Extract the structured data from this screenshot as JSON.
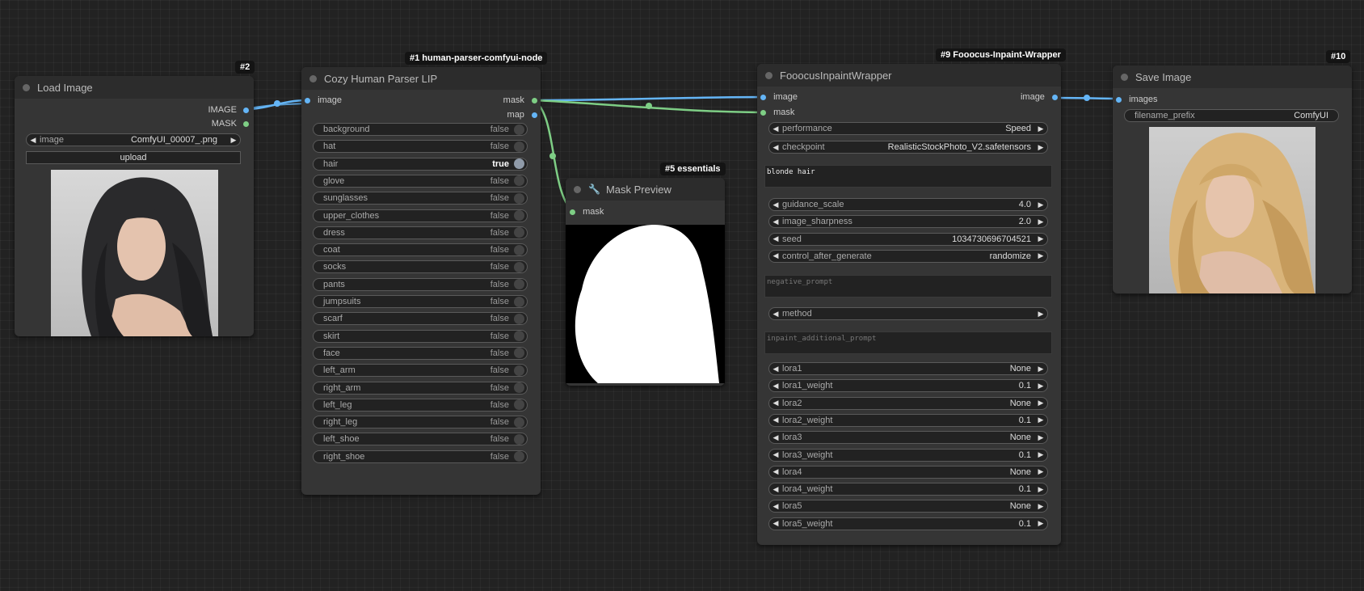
{
  "nodes": {
    "load_image": {
      "badge": "#2",
      "title": "Load Image",
      "outputs": [
        "IMAGE",
        "MASK"
      ],
      "image_widget": {
        "label": "image",
        "value": "ComfyUI_00007_.png"
      },
      "upload_label": "upload"
    },
    "parser": {
      "badge": "#1 human-parser-comfyui-node",
      "title": "Cozy Human Parser LIP",
      "input": "image",
      "outputs": [
        "mask",
        "map"
      ],
      "toggles": [
        {
          "label": "background",
          "value": "false"
        },
        {
          "label": "hat",
          "value": "false"
        },
        {
          "label": "hair",
          "value": "true"
        },
        {
          "label": "glove",
          "value": "false"
        },
        {
          "label": "sunglasses",
          "value": "false"
        },
        {
          "label": "upper_clothes",
          "value": "false"
        },
        {
          "label": "dress",
          "value": "false"
        },
        {
          "label": "coat",
          "value": "false"
        },
        {
          "label": "socks",
          "value": "false"
        },
        {
          "label": "pants",
          "value": "false"
        },
        {
          "label": "jumpsuits",
          "value": "false"
        },
        {
          "label": "scarf",
          "value": "false"
        },
        {
          "label": "skirt",
          "value": "false"
        },
        {
          "label": "face",
          "value": "false"
        },
        {
          "label": "left_arm",
          "value": "false"
        },
        {
          "label": "right_arm",
          "value": "false"
        },
        {
          "label": "left_leg",
          "value": "false"
        },
        {
          "label": "right_leg",
          "value": "false"
        },
        {
          "label": "left_shoe",
          "value": "false"
        },
        {
          "label": "right_shoe",
          "value": "false"
        }
      ]
    },
    "mask_preview": {
      "badge": "#5 essentials",
      "title": "Mask Preview",
      "input": "mask"
    },
    "fooocus": {
      "badge": "#9 Fooocus-Inpaint-Wrapper",
      "title": "FooocusInpaintWrapper",
      "inputs": [
        "image",
        "mask"
      ],
      "output": "image",
      "widgets_top": [
        {
          "label": "performance",
          "value": "Speed"
        },
        {
          "label": "checkpoint",
          "value": "RealisticStockPhoto_V2.safetensors"
        }
      ],
      "prompt": "blonde hair",
      "widgets_mid": [
        {
          "label": "guidance_scale",
          "value": "4.0"
        },
        {
          "label": "image_sharpness",
          "value": "2.0"
        },
        {
          "label": "seed",
          "value": "1034730696704521"
        },
        {
          "label": "control_after_generate",
          "value": "randomize"
        }
      ],
      "negative_placeholder": "negative_prompt",
      "method_label": "method",
      "inpaint_placeholder": "inpaint_additional_prompt",
      "loras": [
        {
          "label": "lora1",
          "value": "None"
        },
        {
          "label": "lora1_weight",
          "value": "0.1"
        },
        {
          "label": "lora2",
          "value": "None"
        },
        {
          "label": "lora2_weight",
          "value": "0.1"
        },
        {
          "label": "lora3",
          "value": "None"
        },
        {
          "label": "lora3_weight",
          "value": "0.1"
        },
        {
          "label": "lora4",
          "value": "None"
        },
        {
          "label": "lora4_weight",
          "value": "0.1"
        },
        {
          "label": "lora5",
          "value": "None"
        },
        {
          "label": "lora5_weight",
          "value": "0.1"
        }
      ]
    },
    "save_image": {
      "badge": "#10",
      "title": "Save Image",
      "input": "images",
      "prefix_widget": {
        "label": "filename_prefix",
        "value": "ComfyUI"
      }
    }
  },
  "colors": {
    "image_link": "#64b5f6",
    "mask_link": "#7ece85",
    "canvas": "#222222",
    "node_body": "#353535"
  }
}
